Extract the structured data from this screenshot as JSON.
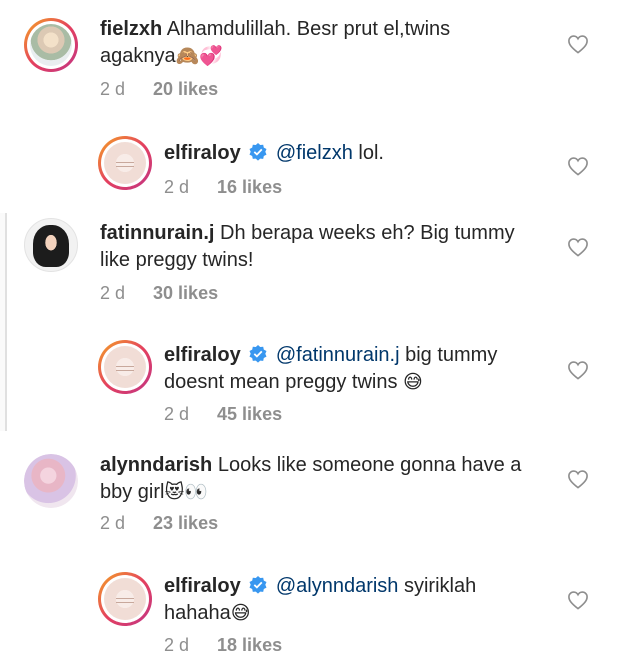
{
  "comments": [
    {
      "username": "fielzxh",
      "text_line1": "Alhamdulillah. Besr prut el,twins",
      "text_line2": "agaknya",
      "emoji": "🙈💞",
      "time": "2 d",
      "likes": "20 likes"
    },
    {
      "username": "elfiraloy",
      "mention": "@fielzxh",
      "text": "lol.",
      "time": "2 d",
      "likes": "16 likes"
    },
    {
      "username": "fatinnurain.j",
      "text_line1": "Dh berapa weeks eh? Big tummy",
      "text_line2": "like preggy twins!",
      "time": "2 d",
      "likes": "30 likes"
    },
    {
      "username": "elfiraloy",
      "mention": "@fatinnurain.j",
      "text_line1": "big tummy",
      "text_line2": "doesnt mean preggy twins",
      "emoji": "😅",
      "time": "2 d",
      "likes": "45 likes"
    },
    {
      "username": "alynndarish",
      "text_line1": "Looks like someone gonna have a",
      "text_line2": "bby girl",
      "emoji": "😻👀",
      "time": "2 d",
      "likes": "23 likes"
    },
    {
      "username": "elfiraloy",
      "mention": "@alynndarish",
      "text_line1": "syiriklah",
      "text_line2": "hahaha",
      "emoji": "😅",
      "time": "2 d",
      "likes": "18 likes"
    }
  ],
  "icons": {
    "like": "heart-outline-icon",
    "verified": "verified-badge-icon"
  },
  "colors": {
    "text": "#262626",
    "meta": "#8e8e8e",
    "mention": "#00376b",
    "verified": "#3897f0"
  }
}
